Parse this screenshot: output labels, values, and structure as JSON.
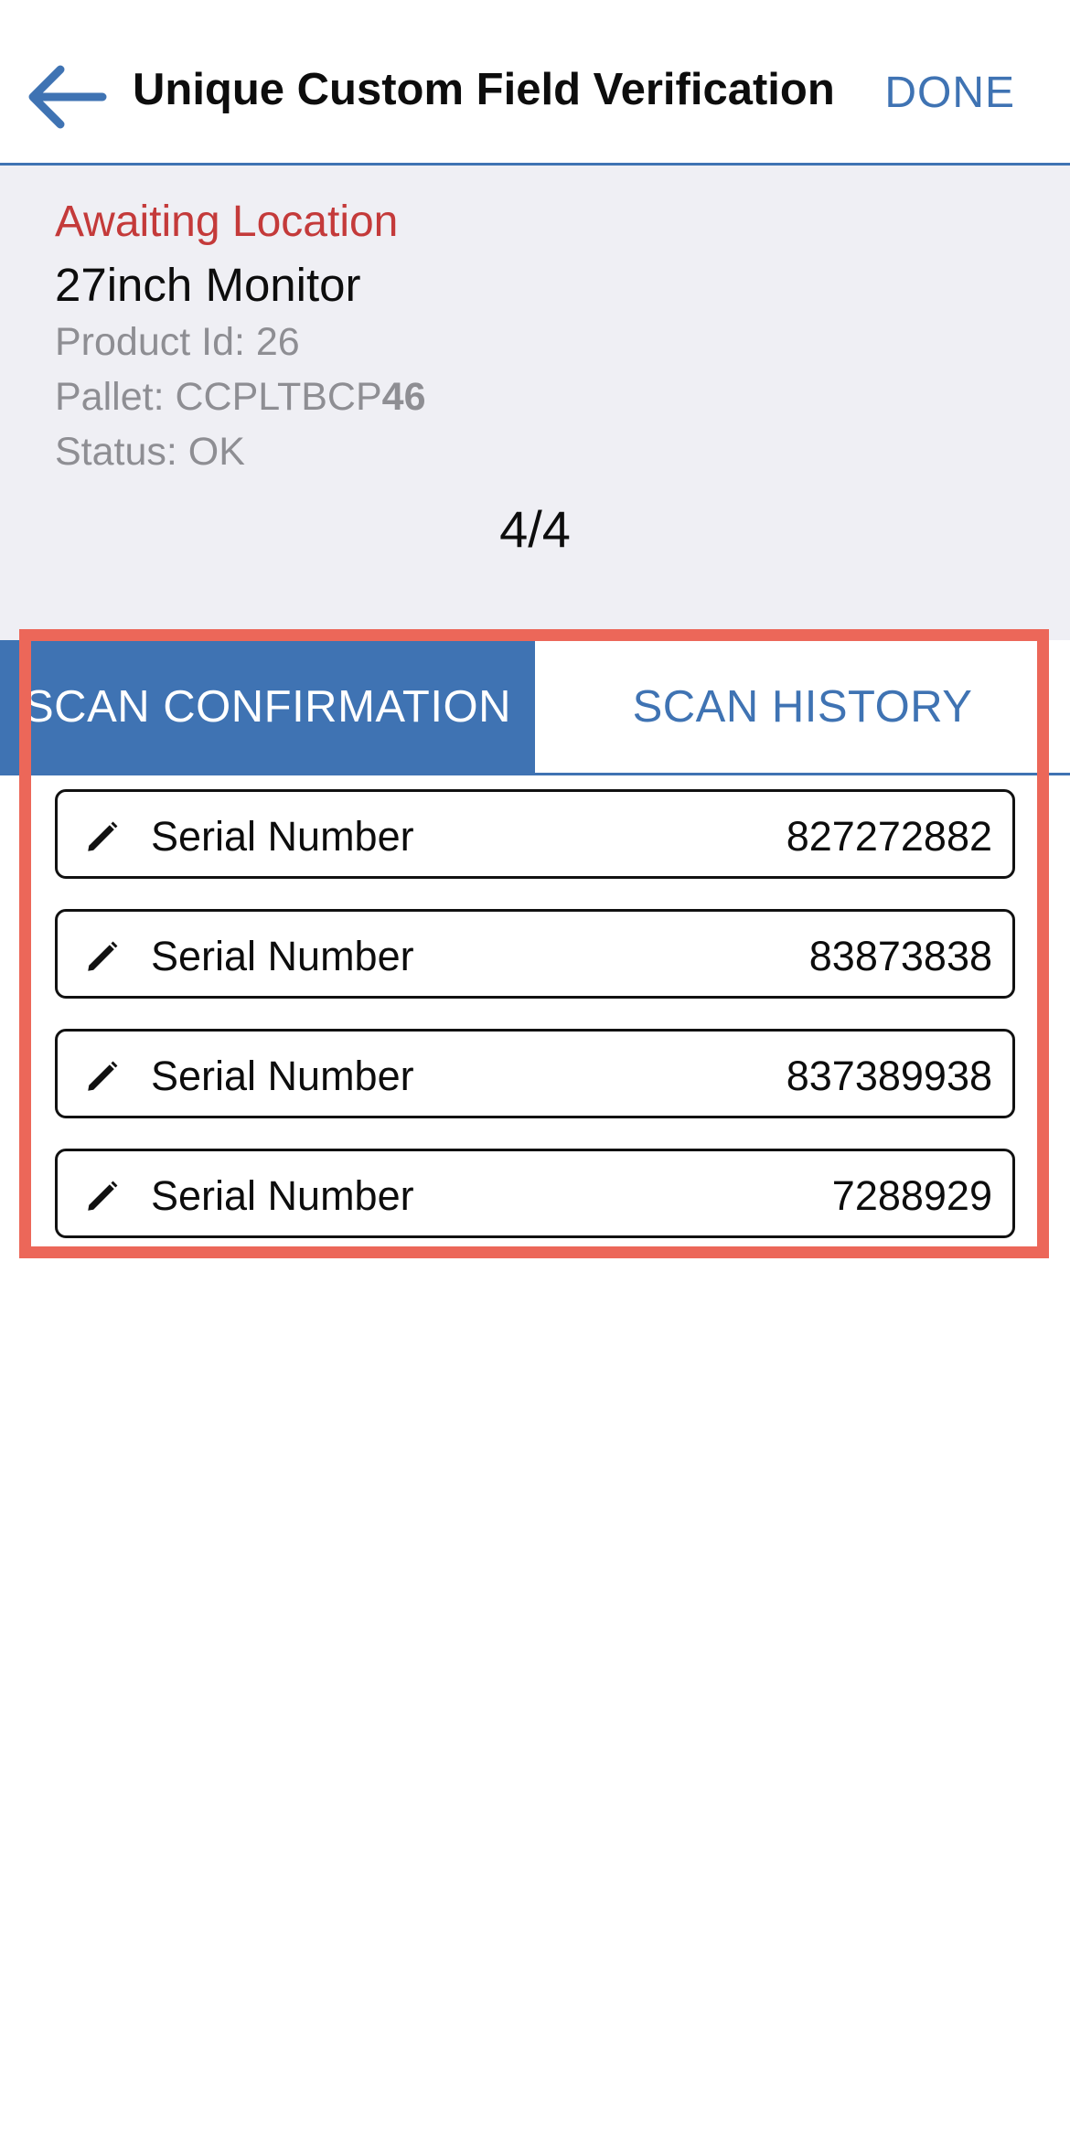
{
  "header": {
    "title": "Unique Custom Field Verification",
    "done_label": "DONE",
    "back_icon": "arrow-left-icon",
    "accent_color": "#3f73b3"
  },
  "info": {
    "status": "Awaiting Location",
    "status_color": "#c43a3a",
    "product_name": "27inch Monitor",
    "product_id_label": "Product Id: 26",
    "pallet_prefix": "Pallet: CCPLTBCP",
    "pallet_bold": "46",
    "status_line": "Status: OK",
    "counter": "4/4"
  },
  "tabs": [
    {
      "label": "SCAN CONFIRMATION",
      "active": true
    },
    {
      "label": "SCAN HISTORY",
      "active": false
    }
  ],
  "rows": [
    {
      "label": "Serial Number",
      "value": "827272882",
      "icon": "pencil-icon"
    },
    {
      "label": "Serial Number",
      "value": "83873838",
      "icon": "pencil-icon"
    },
    {
      "label": "Serial Number",
      "value": "837389938",
      "icon": "pencil-icon"
    },
    {
      "label": "Serial Number",
      "value": "7288929",
      "icon": "pencil-icon"
    }
  ]
}
